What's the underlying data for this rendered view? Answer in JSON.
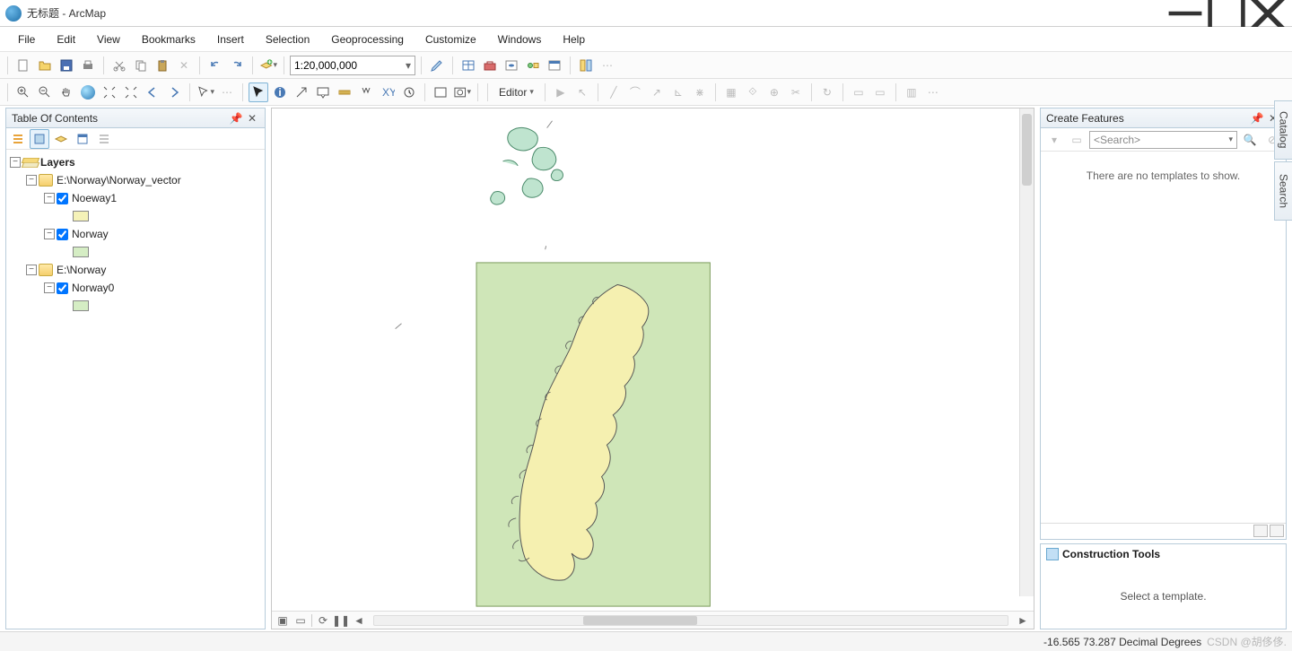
{
  "window": {
    "title": "无标题 - ArcMap"
  },
  "menus": [
    "File",
    "Edit",
    "View",
    "Bookmarks",
    "Insert",
    "Selection",
    "Geoprocessing",
    "Customize",
    "Windows",
    "Help"
  ],
  "scale": "1:20,000,000",
  "editor_label": "Editor",
  "toc": {
    "title": "Table Of Contents",
    "root": "Layers",
    "group1": "E:\\Norway\\Norway_vector",
    "layer1": "Noeway1",
    "layer2": "Norway",
    "group2": "E:\\Norway",
    "layer3": "Norway0"
  },
  "create_features": {
    "title": "Create Features",
    "search_placeholder": "<Search>",
    "empty_text": "There are no templates to show."
  },
  "construction": {
    "title": "Construction Tools",
    "hint": "Select a template."
  },
  "side_tabs": [
    "Catalog",
    "Search"
  ],
  "status": {
    "coords": "-16.565  73.287 Decimal Degrees",
    "watermark": "CSDN @胡侈侈."
  }
}
